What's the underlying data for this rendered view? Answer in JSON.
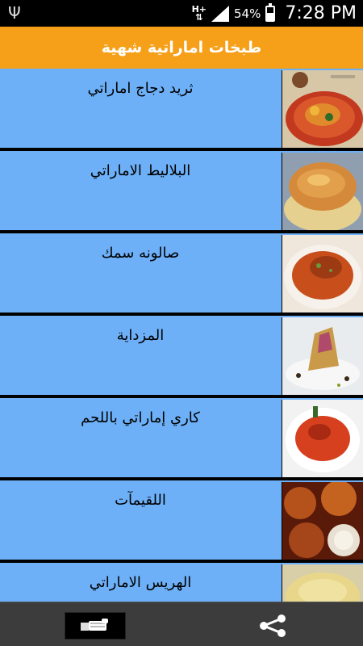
{
  "status_bar": {
    "usb_icon": "usb-icon",
    "network": "H+",
    "battery_percent": "54%",
    "battery_level": 0.54,
    "time": "7:28 PM"
  },
  "app_bar": {
    "title": "طبخات اماراتية شهية"
  },
  "recipes": [
    {
      "title": "ثريد دجاج اماراتي",
      "thumb": "tharid-chicken-image"
    },
    {
      "title": "البلاليط الاماراتي",
      "thumb": "balaleet-image"
    },
    {
      "title": "صالونه سمك",
      "thumb": "saloona-fish-image"
    },
    {
      "title": "المزداية",
      "thumb": "mazdaya-image"
    },
    {
      "title": "كاري إماراتي باللحم",
      "thumb": "curry-meat-image"
    },
    {
      "title": "اللقيمآت",
      "thumb": "luqaimat-image"
    },
    {
      "title": "الهريس الاماراتي",
      "thumb": "harees-image"
    }
  ],
  "bottom_bar": {
    "rate_icon": "thumbs-up-hand-icon",
    "share_icon": "share-icon"
  },
  "colors": {
    "app_bar": "#f6a019",
    "list_row": "#6db0f7",
    "bottom_bar": "#3c3c3c"
  }
}
